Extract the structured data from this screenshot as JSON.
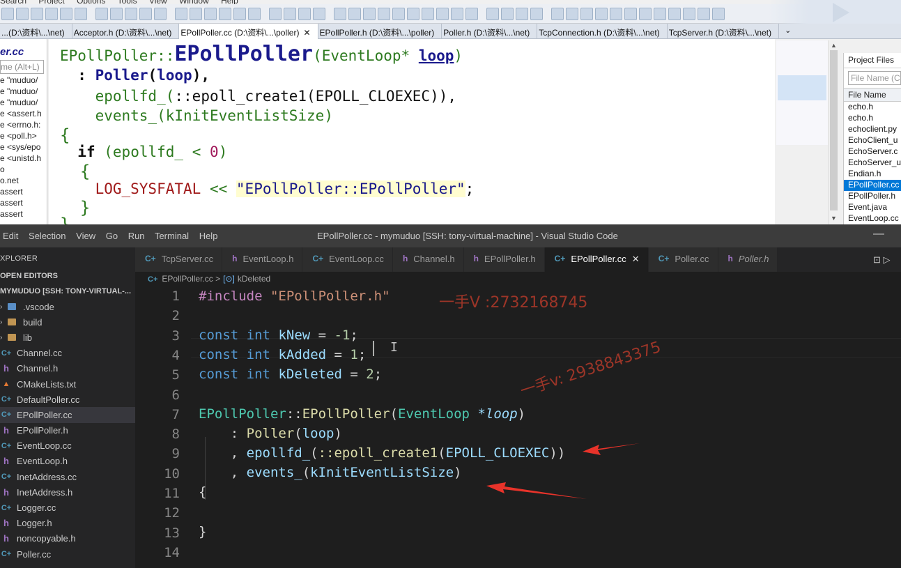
{
  "top_window": {
    "menu": [
      "Search",
      "Project",
      "Options",
      "Tools",
      "View",
      "Window",
      "Help"
    ],
    "file_tabs": [
      {
        "label": "...(D:\\资料\\...\\net)",
        "active": false,
        "closable": false
      },
      {
        "label": "Acceptor.h (D:\\资料\\...\\net)",
        "active": false,
        "closable": false
      },
      {
        "label": "EPollPoller.cc (D:\\资料\\...\\poller)",
        "active": true,
        "closable": true
      },
      {
        "label": "EPollPoller.h (D:\\资料\\...\\poller)",
        "active": false,
        "closable": false
      },
      {
        "label": "Poller.h (D:\\资料\\...\\net)",
        "active": false,
        "closable": false
      },
      {
        "label": "TcpConnection.h (D:\\资料\\...\\net)",
        "active": false,
        "closable": false
      },
      {
        "label": "TcpServer.h (D:\\资料\\...\\net)",
        "active": false,
        "closable": false
      }
    ],
    "tab_close_glyph": "✕",
    "tab_more_glyph": "⌄",
    "symbol_panel": {
      "title": "er.cc",
      "search_placeholder": "me (Alt+L)",
      "items": [
        "e \"muduo/",
        "e \"muduo/",
        "e \"muduo/",
        "e <assert.h",
        "e <errno.h:",
        "e <poll.h>",
        "e <sys/epo",
        "e <unistd.h",
        "o",
        "o.net",
        "assert",
        "assert",
        "assert"
      ]
    },
    "code": {
      "class_name": "EPollPoller",
      "scope": "::",
      "ctor_name": "EPollPoller",
      "param_type": "EventLoop*",
      "param_name": "loop",
      "init1_base": "Poller",
      "init1_arg": "loop",
      "init2_member": "epollfd_",
      "init2_call": "::epoll_create1",
      "init2_arg": "EPOLL_CLOEXEC",
      "init3_member": "events_",
      "init3_arg": "kInitEventListSize",
      "if_kw": "if",
      "cond_var": "epollfd_",
      "cond_num": "0",
      "log_macro": "LOG_SYSFATAL",
      "log_str": "\"EPollPoller::EPollPoller\""
    },
    "project_panel": {
      "title": "Project Files",
      "search_placeholder": "File Name (C",
      "column_header": "File Name",
      "files": [
        "echo.h",
        "echo.h",
        "echoclient.py",
        "EchoClient_u",
        "EchoServer.c",
        "EchoServer_u",
        "Endian.h",
        "EPollPoller.cc",
        "EPollPoller.h",
        "Event.java",
        "EventLoop.cc"
      ],
      "selected_index": 7
    }
  },
  "vscode": {
    "menu": [
      "Edit",
      "Selection",
      "View",
      "Go",
      "Run",
      "Terminal",
      "Help"
    ],
    "window_title": "EPollPoller.cc - mymuduo [SSH: tony-virtual-machine] - Visual Studio Code",
    "minimize_glyph": "—",
    "explorer_label": "XPLORER",
    "open_editors_label": "OPEN EDITORS",
    "workspace_label": "MYMUDUO [SSH: TONY-VIRTUAL-...",
    "tree": [
      {
        "name": ".vscode",
        "kind": "folder-blue"
      },
      {
        "name": "build",
        "kind": "folder"
      },
      {
        "name": "lib",
        "kind": "folder"
      },
      {
        "name": "Channel.cc",
        "kind": "cpp"
      },
      {
        "name": "Channel.h",
        "kind": "h"
      },
      {
        "name": "CMakeLists.txt",
        "kind": "cmake"
      },
      {
        "name": "DefaultPoller.cc",
        "kind": "cpp"
      },
      {
        "name": "EPollPoller.cc",
        "kind": "cpp",
        "selected": true
      },
      {
        "name": "EPollPoller.h",
        "kind": "h"
      },
      {
        "name": "EventLoop.cc",
        "kind": "cpp"
      },
      {
        "name": "EventLoop.h",
        "kind": "h"
      },
      {
        "name": "InetAddress.cc",
        "kind": "cpp"
      },
      {
        "name": "InetAddress.h",
        "kind": "h"
      },
      {
        "name": "Logger.cc",
        "kind": "cpp"
      },
      {
        "name": "Logger.h",
        "kind": "h"
      },
      {
        "name": "noncopyable.h",
        "kind": "h"
      },
      {
        "name": "Poller.cc",
        "kind": "cpp"
      }
    ],
    "icon_glyphs": {
      "cpp": "C+",
      "h": "h",
      "cmake": "▲",
      "chevron": "›"
    },
    "tabs": [
      {
        "label": "TcpServer.cc",
        "kind": "cpp"
      },
      {
        "label": "EventLoop.h",
        "kind": "h"
      },
      {
        "label": "EventLoop.cc",
        "kind": "cpp"
      },
      {
        "label": "Channel.h",
        "kind": "h"
      },
      {
        "label": "EPollPoller.h",
        "kind": "h"
      },
      {
        "label": "EPollPoller.cc",
        "kind": "cpp",
        "active": true
      },
      {
        "label": "Poller.cc",
        "kind": "cpp"
      },
      {
        "label": "Poller.h",
        "kind": "h",
        "italic": true
      }
    ],
    "tab_close_glyph": "✕",
    "tab_actions": "⊡ ▷",
    "breadcrumb": {
      "file": "EPollPoller.cc",
      "sep": ">",
      "sym_icon": "[⊙]",
      "symbol": "kDeleted"
    },
    "line_numbers": [
      "1",
      "2",
      "3",
      "4",
      "5",
      "6",
      "7",
      "8",
      "9",
      "10",
      "11",
      "12",
      "13",
      "14"
    ],
    "code": {
      "include_kw": "#include",
      "include_file": "\"EPollPoller.h\"",
      "const": "const",
      "int": "int",
      "kNew": "kNew",
      "kNew_val": "-1",
      "kAdded": "kAdded",
      "kAdded_val": "1",
      "kDeleted": "kDeleted",
      "kDeleted_val": "2",
      "cls": "EPollPoller",
      "scope": "::",
      "ctor": "EPollPoller",
      "ptype": "EventLoop",
      "pname": "*loop",
      "base": "Poller",
      "base_arg": "loop",
      "m1": "epollfd_",
      "m1_call": "::epoll_create1",
      "m1_arg": "EPOLL_CLOEXEC",
      "m2": "events_",
      "m2_arg": "kInitEventListSize",
      "lbrace": "{",
      "rbrace": "}",
      "ibeam": "I"
    }
  },
  "watermarks": {
    "w1": "一手V :2732168745",
    "w2": "一手v: 2938843375"
  },
  "colors": {
    "arrow": "#e8332a",
    "vscode_bg": "#1e1e1e",
    "selection_blue": "#0078d7"
  }
}
